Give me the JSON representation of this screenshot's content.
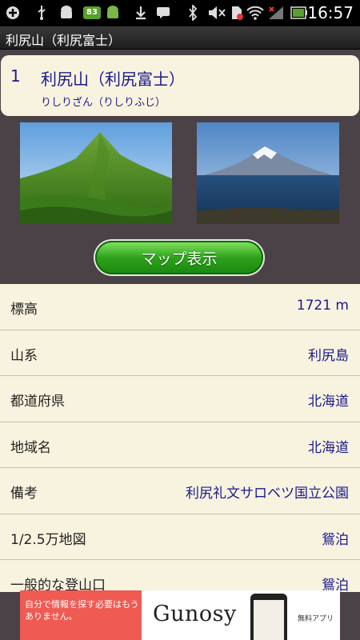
{
  "status_bar": {
    "time": "16:57",
    "badge": "83",
    "icons": [
      "plus-icon",
      "usb-icon",
      "android-icon",
      "android-green-icon",
      "download-icon",
      "message-icon",
      "bluetooth-icon",
      "mute-icon",
      "sim-alert-icon",
      "wifi-icon",
      "signal-icon",
      "battery-icon"
    ]
  },
  "title_bar": {
    "title": "利尻山（利尻富士）"
  },
  "header": {
    "number": "1",
    "name": "利尻山（利尻富士）",
    "reading": "りしりざん（りしりふじ）"
  },
  "photos": [
    {
      "name": "green-mountain-photo"
    },
    {
      "name": "mount-rishiri-over-sea-photo"
    }
  ],
  "map_button": {
    "label": "マップ表示"
  },
  "info": [
    {
      "label": "標高",
      "value": "1721 m"
    },
    {
      "label": "山系",
      "value": "利尻島"
    },
    {
      "label": "都道府県",
      "value": "北海道"
    },
    {
      "label": "地域名",
      "value": "北海道"
    },
    {
      "label": "備考",
      "value": "利尻礼文サロベツ国立公園"
    },
    {
      "label": "1/2.5万地図",
      "value": "鴛泊"
    },
    {
      "label": "一般的な登山口",
      "value": "鴛泊"
    }
  ],
  "ad": {
    "left_text": "自分で情報を探す必要はもうありません。",
    "brand": "Gunosy",
    "tag": "無料アプリ"
  },
  "colors": {
    "background": "#4b4247",
    "card": "#f8f3df",
    "accent_text": "#1a1a8c",
    "button_green": "#2fa21c",
    "ad_red": "#ef5a53"
  }
}
